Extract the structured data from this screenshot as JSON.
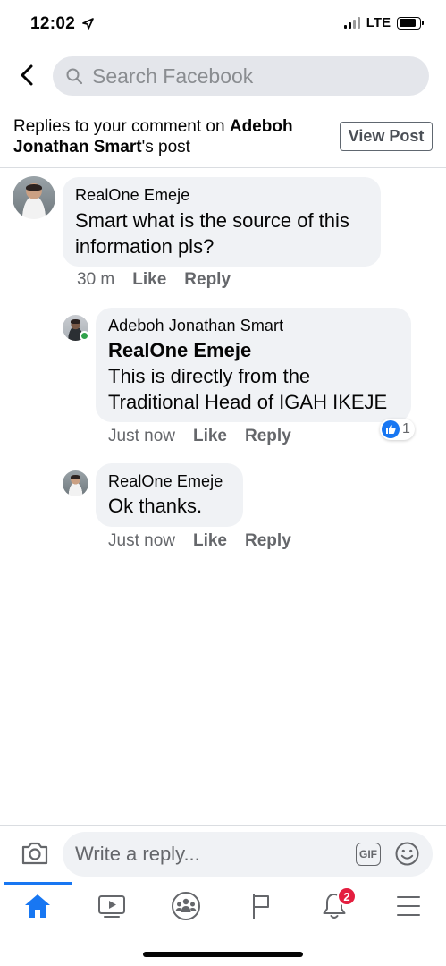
{
  "status_bar": {
    "time": "12:02",
    "carrier": "LTE"
  },
  "header": {
    "search_placeholder": "Search Facebook"
  },
  "title_bar": {
    "prefix": "Replies to your comment on ",
    "author": "Adeboh Jonathan Smart",
    "suffix": "'s post",
    "view_post_label": "View Post"
  },
  "comments": [
    {
      "author": "RealOne Emeje",
      "text_line1": "Smart what is the source of this",
      "text_line2": "information pls?",
      "time": "30 m",
      "like_label": "Like",
      "reply_label": "Reply"
    },
    {
      "author": "Adeboh Jonathan Smart",
      "mention": "RealOne Emeje",
      "text_line1": "This is directly from the",
      "text_line2": "Traditional Head of IGAH IKEJE",
      "time": "Just now",
      "like_label": "Like",
      "reply_label": "Reply",
      "reaction_count": "1"
    },
    {
      "author": "RealOne Emeje",
      "text": "Ok thanks.",
      "time": "Just now",
      "like_label": "Like",
      "reply_label": "Reply"
    }
  ],
  "composer": {
    "placeholder": "Write a reply...",
    "gif_label": "GIF"
  },
  "tabbar": {
    "tabs": [
      "home",
      "watch",
      "groups",
      "pages",
      "notifications",
      "menu"
    ],
    "active": "home",
    "notifications_badge": "2"
  },
  "colors": {
    "accent": "#1877f2",
    "badge": "#e41e3f",
    "bubble": "#f0f2f5",
    "online": "#31a24c"
  }
}
